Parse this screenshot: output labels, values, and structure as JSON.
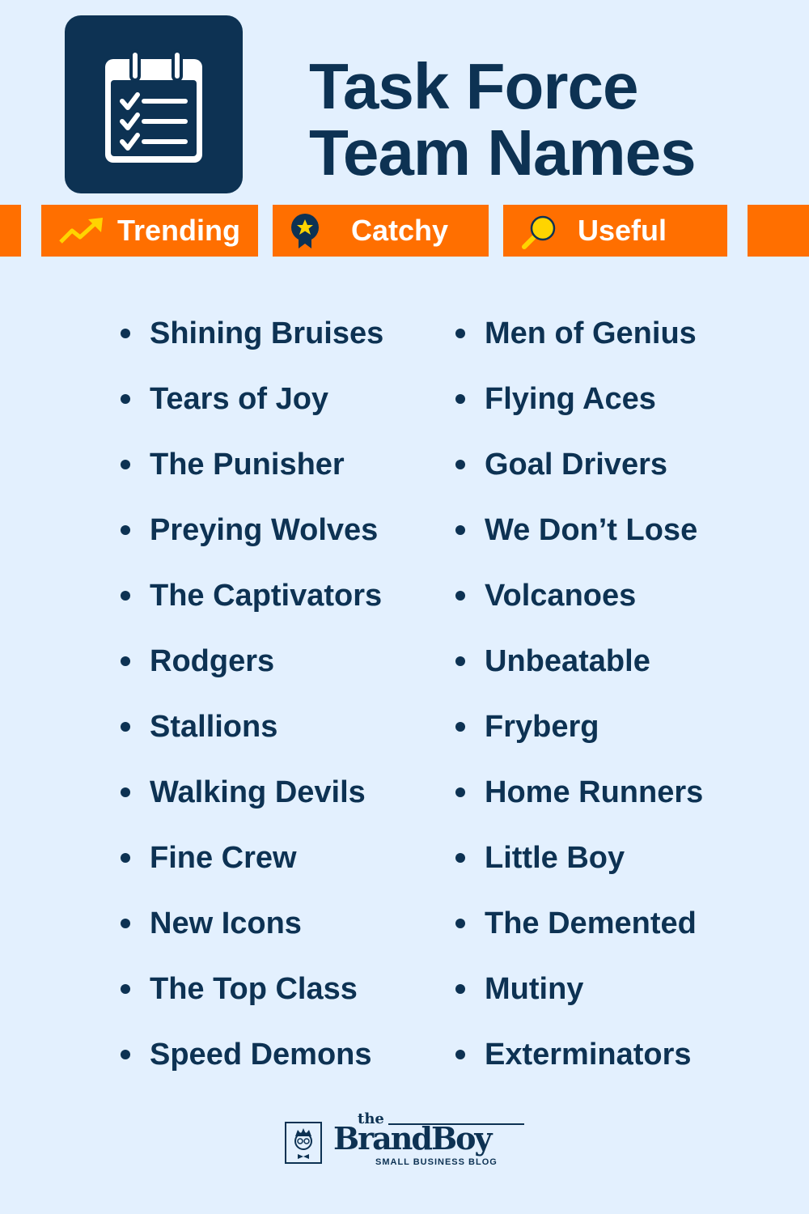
{
  "header": {
    "title_line1": "Task Force",
    "title_line2": "Team Names",
    "icon": "calendar-checklist-icon"
  },
  "tags": [
    {
      "label": "Trending",
      "icon": "trending-up-icon"
    },
    {
      "label": "Catchy",
      "icon": "award-badge-icon"
    },
    {
      "label": "Useful",
      "icon": "magnifier-icon"
    }
  ],
  "colors": {
    "background": "#e3f0fe",
    "primary": "#0d3253",
    "accent": "#ff6f00",
    "icon_yellow": "#ffd400"
  },
  "names_left": [
    "Shining Bruises",
    "Tears of Joy",
    "The Punisher",
    "Preying Wolves",
    "The Captivators",
    "Rodgers",
    "Stallions",
    "Walking Devils",
    "Fine Crew",
    "New Icons",
    "The Top Class",
    "Speed Demons"
  ],
  "names_right": [
    "Men of Genius",
    "Flying Aces",
    "Goal Drivers",
    "We Don’t Lose",
    "Volcanoes",
    "Unbeatable",
    "Fryberg",
    "Home Runners",
    "Little Boy",
    "The Demented",
    "Mutiny",
    "Exterminators"
  ],
  "footer": {
    "brand_prefix": "the",
    "brand_name": "BrandBoy",
    "brand_tagline": "SMALL BUSINESS BLOG"
  }
}
